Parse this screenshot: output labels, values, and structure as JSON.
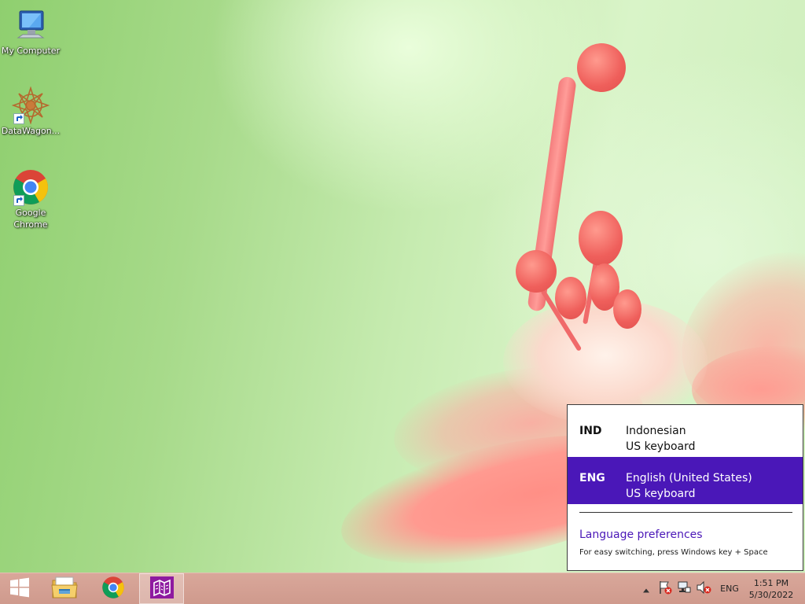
{
  "desktop": {
    "icons": [
      {
        "label": "My Computer",
        "icon": "computer-icon"
      },
      {
        "label": "DataWagon...",
        "icon": "datawagon-icon"
      },
      {
        "label": "Google Chrome",
        "icon": "chrome-icon"
      }
    ]
  },
  "language_flyout": {
    "items": [
      {
        "code": "IND",
        "name": "Indonesian",
        "keyboard": "US keyboard",
        "selected": false
      },
      {
        "code": "ENG",
        "name": "English (United States)",
        "keyboard": "US keyboard",
        "selected": true
      }
    ],
    "preferences_link": "Language preferences",
    "hint": "For easy switching, press Windows key + Space",
    "accent_color": "#4a17b8"
  },
  "taskbar": {
    "pinned": [
      {
        "icon": "windows-start-icon"
      },
      {
        "icon": "file-explorer-icon"
      },
      {
        "icon": "chrome-icon"
      },
      {
        "icon": "app-icon",
        "active": true
      }
    ],
    "tray": {
      "language": "ENG",
      "time": "1:51 PM",
      "date": "5/30/2022"
    },
    "color": "#d4a194"
  }
}
